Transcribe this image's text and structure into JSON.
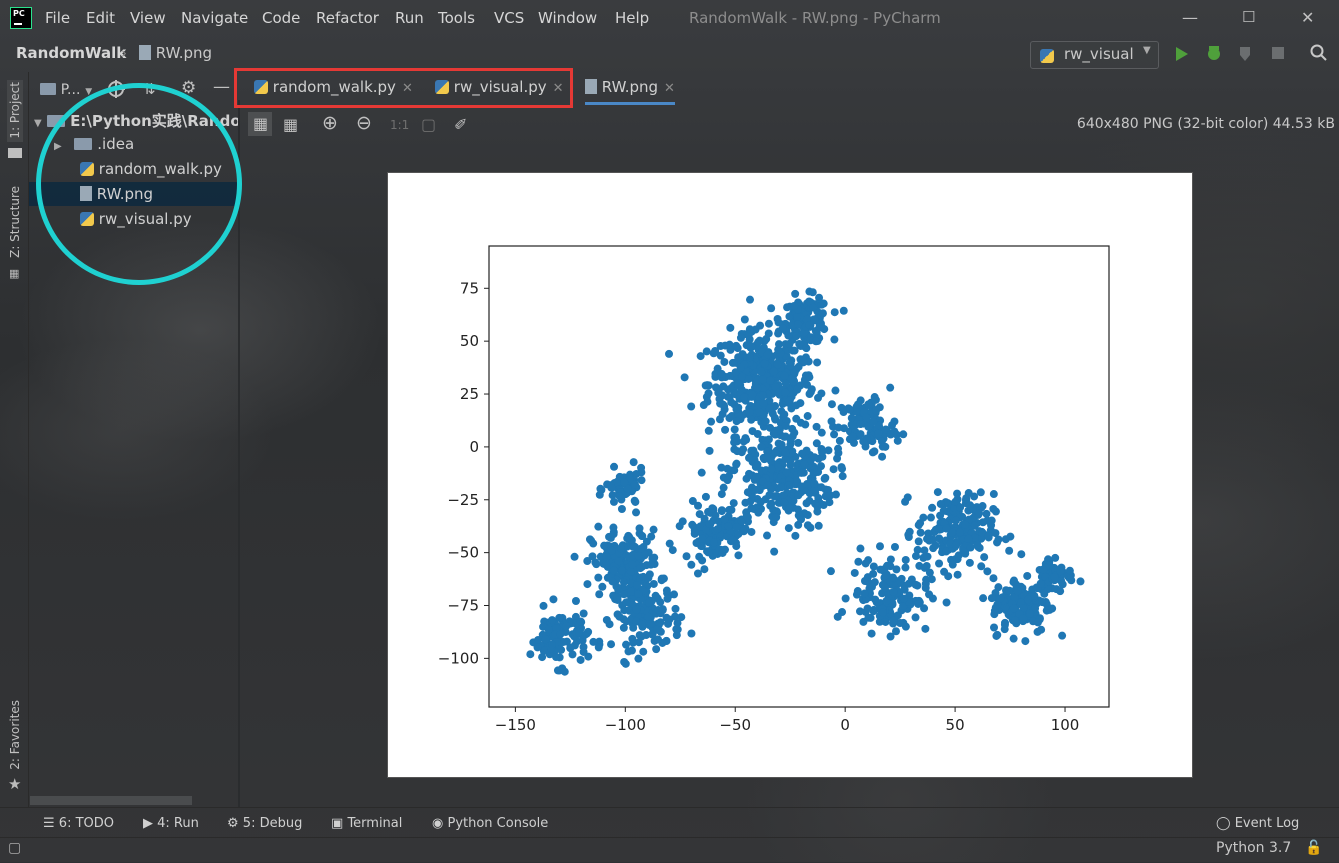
{
  "app": {
    "window_title": "RandomWalk - RW.png - PyCharm",
    "logo_text": "PC"
  },
  "menu": [
    "File",
    "Edit",
    "View",
    "Navigate",
    "Code",
    "Refactor",
    "Run",
    "Tools",
    "VCS",
    "Window",
    "Help"
  ],
  "nav": {
    "project": "RandomWalk",
    "file": "RW.png",
    "run_config": "rw_visual"
  },
  "left_strip": {
    "project": "1: Project",
    "structure": "Z: Structure",
    "favorites": "2: Favorites"
  },
  "project_panel": {
    "header": "P...",
    "root": "E:\\Python实践\\Rando",
    "items": [
      {
        "label": ".idea",
        "icon": "folder-icon"
      },
      {
        "label": "random_walk.py",
        "icon": "python-file-icon"
      },
      {
        "label": "RW.png",
        "icon": "image-file-icon"
      },
      {
        "label": "rw_visual.py",
        "icon": "python-file-icon"
      }
    ]
  },
  "tabs": [
    {
      "label": "random_walk.py"
    },
    {
      "label": "rw_visual.py"
    },
    {
      "label": "RW.png"
    }
  ],
  "image_viewer": {
    "info": "640x480 PNG (32-bit color) 44.53 kB",
    "zoom_ratio": "1:1"
  },
  "chart_data": {
    "type": "scatter",
    "title": "",
    "xlabel": "",
    "ylabel": "",
    "xlim": [
      -162,
      120
    ],
    "ylim": [
      -123,
      95
    ],
    "xticks": [
      -150,
      -100,
      -50,
      0,
      50,
      100
    ],
    "yticks": [
      75,
      50,
      25,
      0,
      -25,
      -50,
      -75,
      -100
    ],
    "xtick_labels": [
      "−150",
      "−100",
      "−50",
      "0",
      "50",
      "100"
    ],
    "ytick_labels": [
      "75",
      "50",
      "25",
      "0",
      "−25",
      "−50",
      "−75",
      "−100"
    ],
    "color": "#1f77b4",
    "clusters": [
      {
        "x": -38,
        "y": 30,
        "spread": 22,
        "n": 420
      },
      {
        "x": -18,
        "y": 60,
        "spread": 10,
        "n": 120
      },
      {
        "x": -30,
        "y": -15,
        "spread": 22,
        "n": 300
      },
      {
        "x": -100,
        "y": -55,
        "spread": 14,
        "n": 180
      },
      {
        "x": -90,
        "y": -80,
        "spread": 14,
        "n": 140
      },
      {
        "x": -130,
        "y": -90,
        "spread": 12,
        "n": 100
      },
      {
        "x": -100,
        "y": -20,
        "spread": 8,
        "n": 60
      },
      {
        "x": 20,
        "y": -70,
        "spread": 16,
        "n": 140
      },
      {
        "x": 50,
        "y": -40,
        "spread": 16,
        "n": 200
      },
      {
        "x": 80,
        "y": -75,
        "spread": 12,
        "n": 140
      },
      {
        "x": 95,
        "y": -60,
        "spread": 8,
        "n": 60
      },
      {
        "x": -60,
        "y": -40,
        "spread": 12,
        "n": 120
      },
      {
        "x": 10,
        "y": 10,
        "spread": 12,
        "n": 100
      }
    ]
  },
  "bottom_tools": [
    "6: TODO",
    "4: Run",
    "5: Debug",
    "Terminal",
    "Python Console"
  ],
  "event_log": "Event Log",
  "status": {
    "interpreter": "Python 3.7"
  },
  "colors": {
    "highlight_box": "#e53935",
    "highlight_circle": "#1fd1d1",
    "selection": "#0d293e"
  }
}
